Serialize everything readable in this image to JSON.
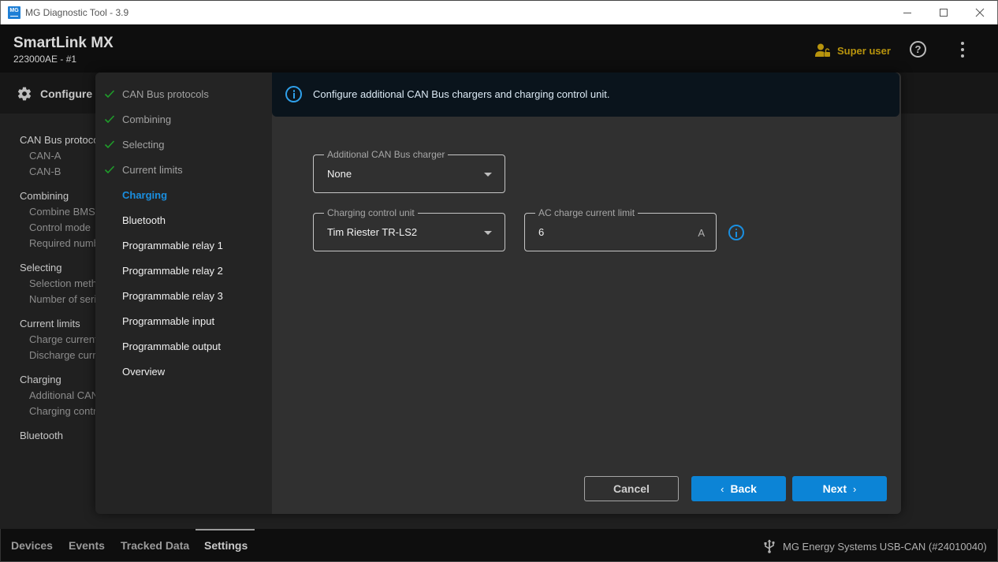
{
  "window": {
    "title": "MG Diagnostic Tool - 3.9",
    "icon_label": "MG"
  },
  "header": {
    "device_name": "SmartLink MX",
    "device_serial": "223000AE - #1",
    "user_role": "Super user",
    "help_icon": "help-circle-icon",
    "menu_icon": "more-vert-icon"
  },
  "page": {
    "section_label": "Configure",
    "outline": [
      {
        "title": "CAN Bus protocols",
        "items": [
          "CAN-A",
          "CAN-B"
        ]
      },
      {
        "title": "Combining",
        "items": [
          "Combine BMSs",
          "Control mode",
          "Required number"
        ]
      },
      {
        "title": "Selecting",
        "items": [
          "Selection method",
          "Number of series"
        ]
      },
      {
        "title": "Current limits",
        "items": [
          "Charge current",
          "Discharge current"
        ]
      },
      {
        "title": "Charging",
        "items": [
          "Additional CAN",
          "Charging control"
        ]
      },
      {
        "title": "Bluetooth",
        "items": []
      }
    ]
  },
  "wizard": {
    "steps": [
      {
        "label": "CAN Bus protocols",
        "state": "done"
      },
      {
        "label": "Combining",
        "state": "done"
      },
      {
        "label": "Selecting",
        "state": "done"
      },
      {
        "label": "Current limits",
        "state": "done"
      },
      {
        "label": "Charging",
        "state": "active"
      },
      {
        "label": "Bluetooth",
        "state": "todo"
      },
      {
        "label": "Programmable relay 1",
        "state": "todo"
      },
      {
        "label": "Programmable relay 2",
        "state": "todo"
      },
      {
        "label": "Programmable relay 3",
        "state": "todo"
      },
      {
        "label": "Programmable input",
        "state": "todo"
      },
      {
        "label": "Programmable output",
        "state": "todo"
      },
      {
        "label": "Overview",
        "state": "todo"
      }
    ],
    "banner_text": "Configure additional CAN Bus chargers and charging control unit.",
    "fields": {
      "additional_charger": {
        "label": "Additional CAN Bus charger",
        "value": "None"
      },
      "charging_control_unit": {
        "label": "Charging control unit",
        "value": "Tim Riester TR-LS2"
      },
      "ac_charge_current_limit": {
        "label": "AC charge current limit",
        "value": "6",
        "unit": "A"
      }
    },
    "buttons": {
      "cancel": "Cancel",
      "back": "Back",
      "next": "Next"
    }
  },
  "bottom_nav": {
    "tabs": [
      {
        "label": "Devices",
        "active": false
      },
      {
        "label": "Events",
        "active": false
      },
      {
        "label": "Tracked Data",
        "active": false
      },
      {
        "label": "Settings",
        "active": true
      }
    ],
    "connection_status": "MG Energy Systems USB-CAN (#24010040)"
  },
  "colors": {
    "accent": "#0c84d6",
    "active_step": "#1a8fe0",
    "check_green": "#1f9d2a",
    "super_user": "#b8940d",
    "banner_bg": "#0a141c"
  }
}
